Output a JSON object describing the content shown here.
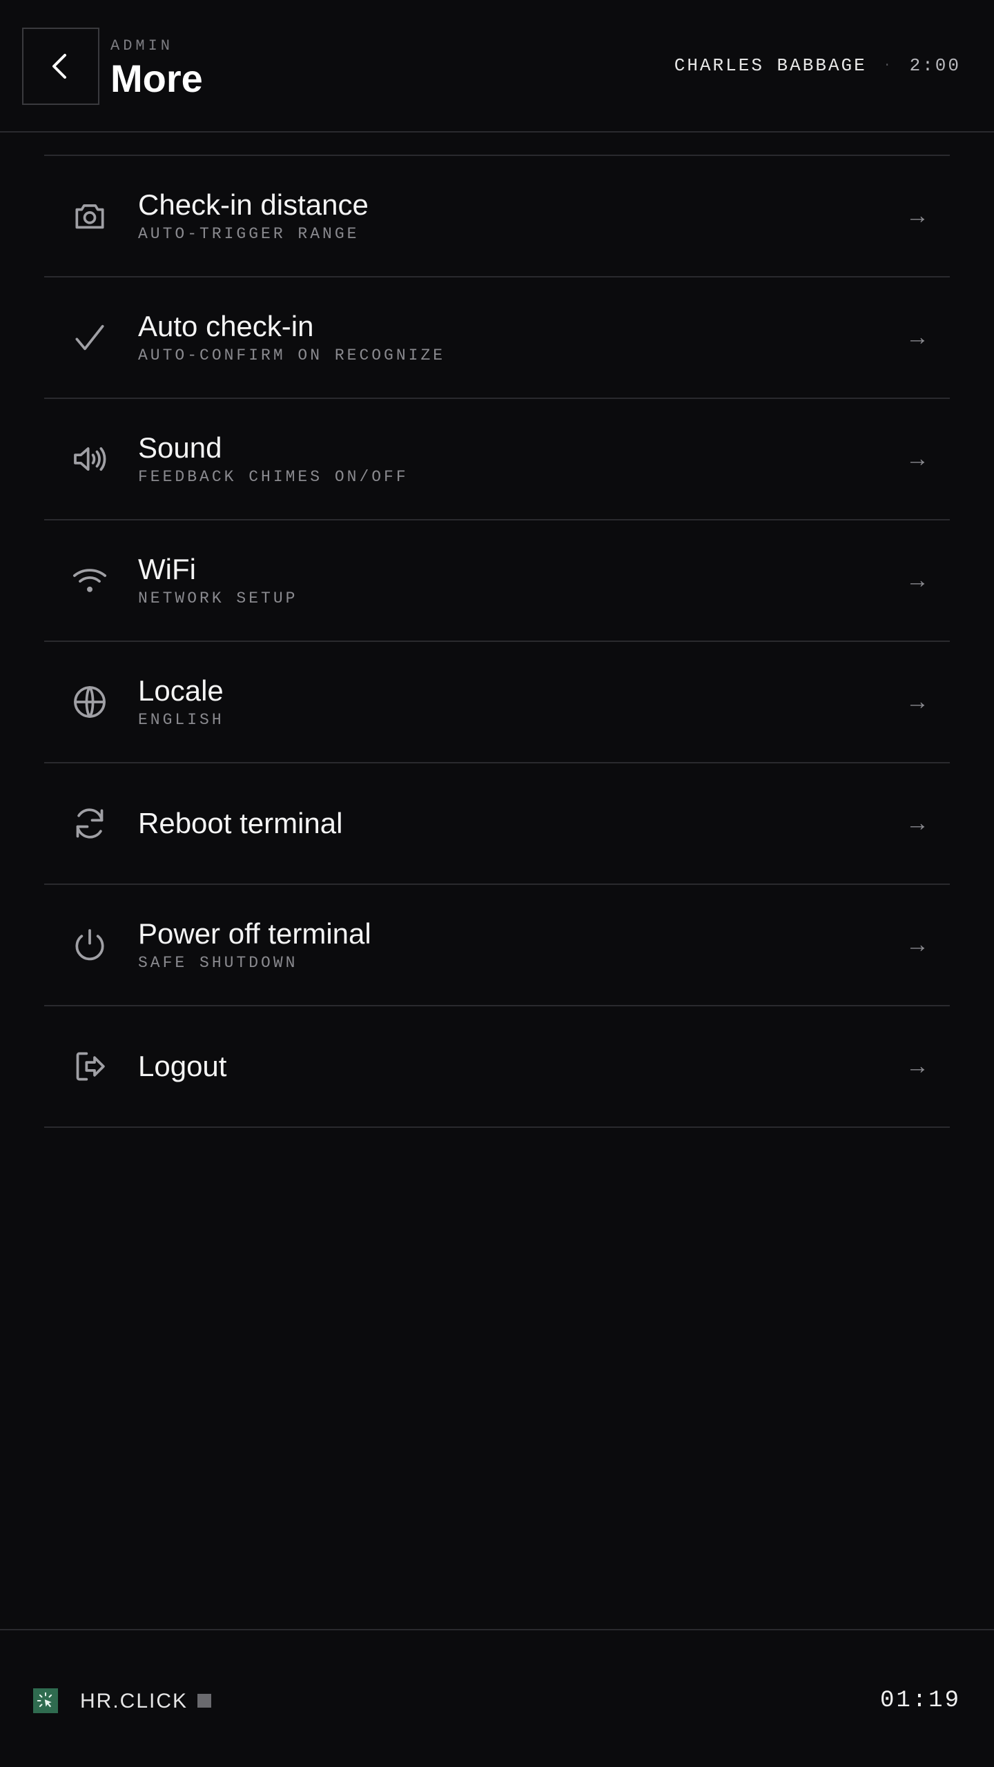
{
  "header": {
    "back_icon": "chevron-left-icon",
    "eyebrow": "ADMIN",
    "title": "More",
    "user_name": "CHARLES BABBAGE",
    "separator": "·",
    "time": "2:00"
  },
  "menu": {
    "items": [
      {
        "icon": "camera-icon",
        "label": "Check-in distance",
        "sub": "AUTO-TRIGGER RANGE",
        "arrow": "→"
      },
      {
        "icon": "check-icon",
        "label": "Auto check-in",
        "sub": "AUTO-CONFIRM ON RECOGNIZE",
        "arrow": "→"
      },
      {
        "icon": "speaker-icon",
        "label": "Sound",
        "sub": "FEEDBACK CHIMES ON/OFF",
        "arrow": "→"
      },
      {
        "icon": "wifi-icon",
        "label": "WiFi",
        "sub": "NETWORK SETUP",
        "arrow": "→"
      },
      {
        "icon": "globe-icon",
        "label": "Locale",
        "sub": "ENGLISH",
        "arrow": "→"
      },
      {
        "icon": "refresh-icon",
        "label": "Reboot terminal",
        "sub": "",
        "arrow": "→"
      },
      {
        "icon": "power-icon",
        "label": "Power off terminal",
        "sub": "SAFE SHUTDOWN",
        "arrow": "→"
      },
      {
        "icon": "logout-icon",
        "label": "Logout",
        "sub": "",
        "arrow": "→"
      }
    ]
  },
  "footer": {
    "logo_icon": "hr-click-logo-icon",
    "brand": "HR.CLICK",
    "status_icon": "status-square-icon",
    "clock": "01:19"
  },
  "colors": {
    "background": "#0b0b0d",
    "divider": "#2a2a2e",
    "accent_green": "#2f6b4f",
    "muted_text": "#8a8a8f"
  }
}
